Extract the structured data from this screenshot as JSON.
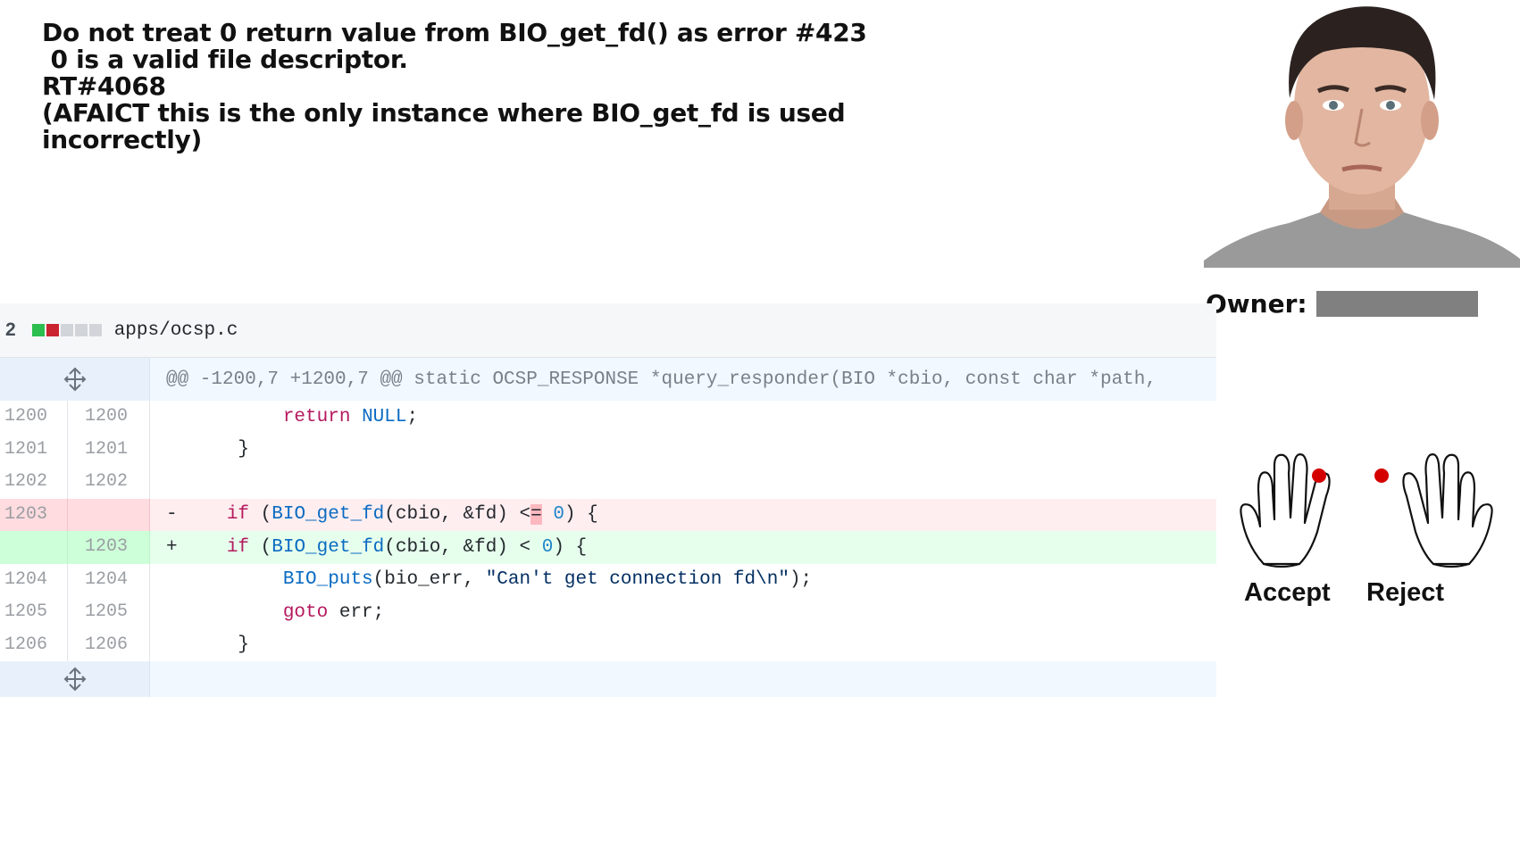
{
  "commit": {
    "lines": [
      "Do not treat 0 return value from BIO_get_fd() as error #423",
      " 0 is a valid file descriptor.",
      "RT#4068",
      "(AFAICT this is the only instance where BIO_get_fd is used",
      "incorrectly)"
    ]
  },
  "owner": {
    "label": "Owner:"
  },
  "diff": {
    "change_count": "2",
    "file_path": "apps/ocsp.c",
    "diffstat": {
      "added": 1,
      "removed": 1,
      "neutral": 3,
      "colors": {
        "added": "#2cbe4e",
        "removed": "#cb2431",
        "neutral": "#d1d5da"
      }
    },
    "hunk_header": "@@ -1200,7 +1200,7 @@ static OCSP_RESPONSE *query_responder(BIO *cbio, const char *path,",
    "rows": [
      {
        "type": "ctx",
        "old": "1200",
        "new": "1200"
      },
      {
        "type": "ctx",
        "old": "1201",
        "new": "1201"
      },
      {
        "type": "ctx",
        "old": "1202",
        "new": "1202"
      },
      {
        "type": "del",
        "old": "1203",
        "new": ""
      },
      {
        "type": "add",
        "old": "",
        "new": "1203"
      },
      {
        "type": "ctx",
        "old": "1204",
        "new": "1204"
      },
      {
        "type": "ctx",
        "old": "1205",
        "new": "1205"
      },
      {
        "type": "ctx",
        "old": "1206",
        "new": "1206"
      }
    ],
    "code": {
      "l1200": {
        "indent": "        ",
        "kw": "return",
        "sp": " ",
        "val": "NULL",
        "tail": ";"
      },
      "l1201": {
        "text": "    }"
      },
      "l1203_del": {
        "marker": "-",
        "indent": "   ",
        "kw": "if",
        "open": " (",
        "fn": "BIO_get_fd",
        "args": "(cbio, &fd) <",
        "hl": "=",
        "sp": " ",
        "num": "0",
        "tail": ") {"
      },
      "l1203_add": {
        "marker": "+",
        "indent": "   ",
        "kw": "if",
        "open": " (",
        "fn": "BIO_get_fd",
        "args": "(cbio, &fd) < ",
        "num": "0",
        "tail": ") {"
      },
      "l1204": {
        "indent": "        ",
        "fn": "BIO_puts",
        "args": "(bio_err, ",
        "str": "\"Can't get connection fd\\n\"",
        "tail": ");"
      },
      "l1205": {
        "indent": "        ",
        "kw": "goto",
        "tail": " err;"
      },
      "l1206": {
        "text": "    }"
      }
    }
  },
  "decision": {
    "accept_label": "Accept",
    "reject_label": "Reject",
    "marker_color": "#d40000"
  }
}
